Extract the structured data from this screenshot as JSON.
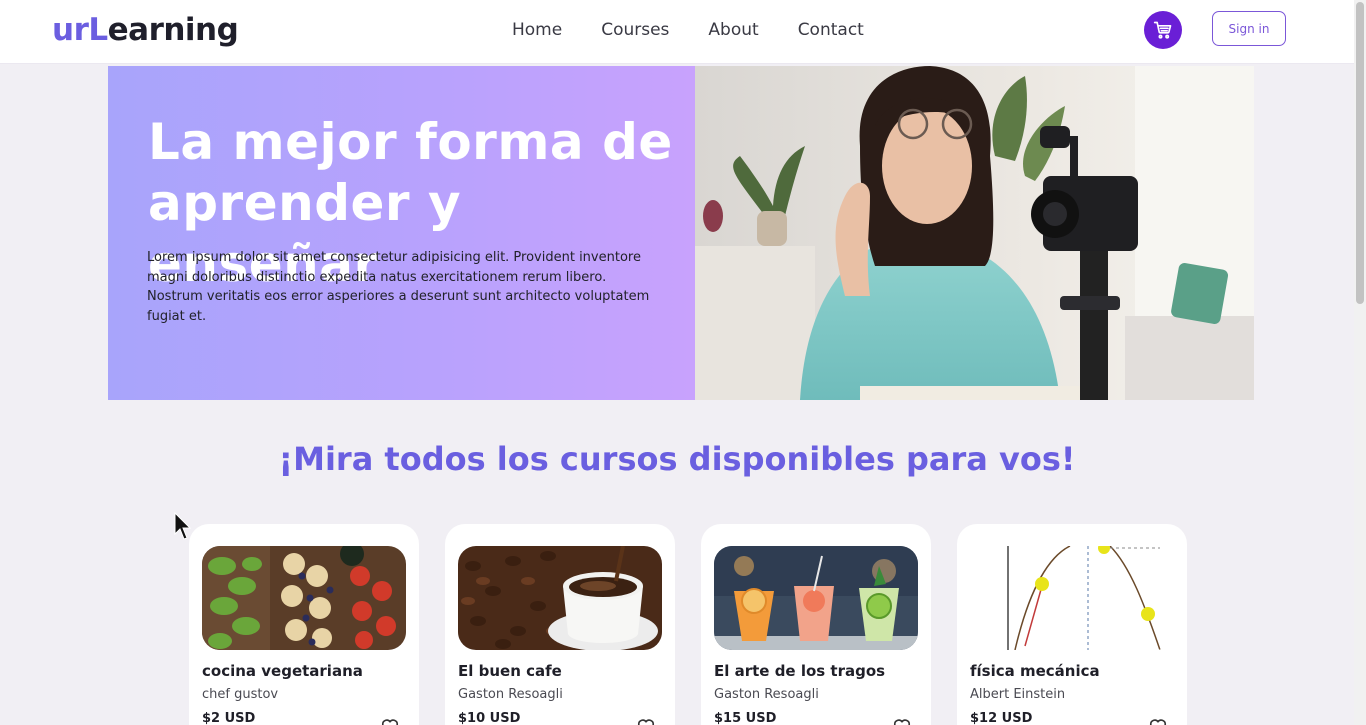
{
  "header": {
    "logo_accent": "urL",
    "logo_rest": "earning",
    "nav": [
      "Home",
      "Courses",
      "About",
      "Contact"
    ],
    "cart_icon": "shopping-cart-icon",
    "signin_label": "Sign in"
  },
  "hero": {
    "title_line1": "La mejor forma de",
    "title_line2": "aprender y enseñar",
    "text": "Lorem ipsum dolor sit amet consectetur adipisicing elit. Provident inventore magni doloribus distinctio expedita natus exercitationem rerum libero. Nostrum veritatis eos error asperiores a deserunt sunt architecto voluptatem fugiat et."
  },
  "section": {
    "title": "¡Mira todos los cursos disponibles para vos!"
  },
  "courses": [
    {
      "title": "cocina vegetariana",
      "author": "chef gustov",
      "price": "$2 USD"
    },
    {
      "title": "El buen cafe",
      "author": "Gaston Resoagli",
      "price": "$10 USD"
    },
    {
      "title": "El arte de los tragos",
      "author": "Gaston Resoagli",
      "price": "$15 USD"
    },
    {
      "title": "física mecánica",
      "author": "Albert Einstein",
      "price": "$12 USD"
    }
  ],
  "colors": {
    "accent": "#6b5ee0",
    "cart_bg": "#6a1fd6",
    "hero_gradient_start": "#a8a4fb",
    "hero_gradient_end": "#c8a2fd"
  }
}
